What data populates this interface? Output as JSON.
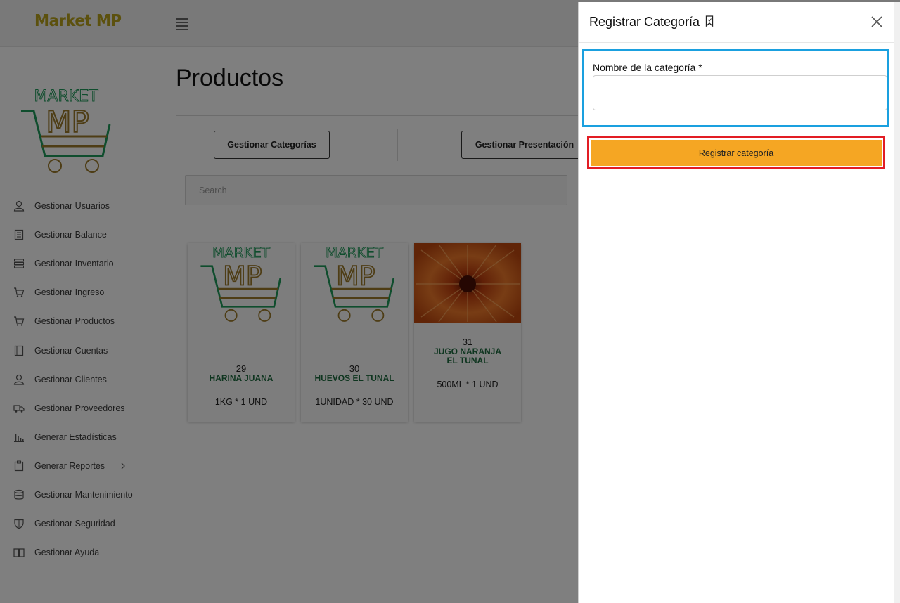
{
  "topbar": {
    "brand": "Market MP",
    "menu_icon": "hamburger-icon"
  },
  "logo": {
    "line1": "MARKET",
    "line2": "MP"
  },
  "sidebar": {
    "items": [
      {
        "label": "Gestionar Usuarios",
        "icon": "user-icon"
      },
      {
        "label": "Gestionar Balance",
        "icon": "ledger-icon"
      },
      {
        "label": "Gestionar Inventario",
        "icon": "list-icon"
      },
      {
        "label": "Gestionar Ingreso",
        "icon": "cart-icon"
      },
      {
        "label": "Gestionar Productos",
        "icon": "cart-icon"
      },
      {
        "label": "Gestionar Cuentas",
        "icon": "book-icon"
      },
      {
        "label": "Gestionar Clientes",
        "icon": "user-icon"
      },
      {
        "label": "Gestionar Proveedores",
        "icon": "truck-icon"
      },
      {
        "label": "Generar Estadísticas",
        "icon": "bar-chart-icon"
      },
      {
        "label": "Generar Reportes",
        "icon": "clipboard-icon"
      },
      {
        "label": "Gestionar Mantenimiento",
        "icon": "database-icon"
      },
      {
        "label": "Gestionar Seguridad",
        "icon": "shield-icon"
      },
      {
        "label": "Gestionar Ayuda",
        "icon": "open-book-icon"
      }
    ]
  },
  "main": {
    "title": "Productos",
    "buttons": {
      "categories": "Gestionar Categorías",
      "presentation": "Gestionar Presentación"
    },
    "search_placeholder": "Search",
    "products": [
      {
        "id": "29",
        "name": "HARINA JUANA",
        "presentation": "1KG * 1 UND",
        "image": "logo"
      },
      {
        "id": "30",
        "name": "HUEVOS EL TUNAL",
        "presentation": "1UNIDAD * 30 UND",
        "image": "logo"
      },
      {
        "id": "31",
        "name_line1": "JUGO NARANJA",
        "name_line2": "EL TUNAL",
        "presentation": "500ML * 1 UND",
        "image": "orange-flower"
      }
    ]
  },
  "panel": {
    "title": "Registrar Categoría",
    "title_icon": "bookmark-icon",
    "field_label": "Nombre de la categoría *",
    "field_value": "",
    "submit_label": "Registrar categoría",
    "colors": {
      "field_highlight": "#1aa0df",
      "submit_highlight": "#e21d24",
      "submit_bg": "#f5a623"
    }
  }
}
